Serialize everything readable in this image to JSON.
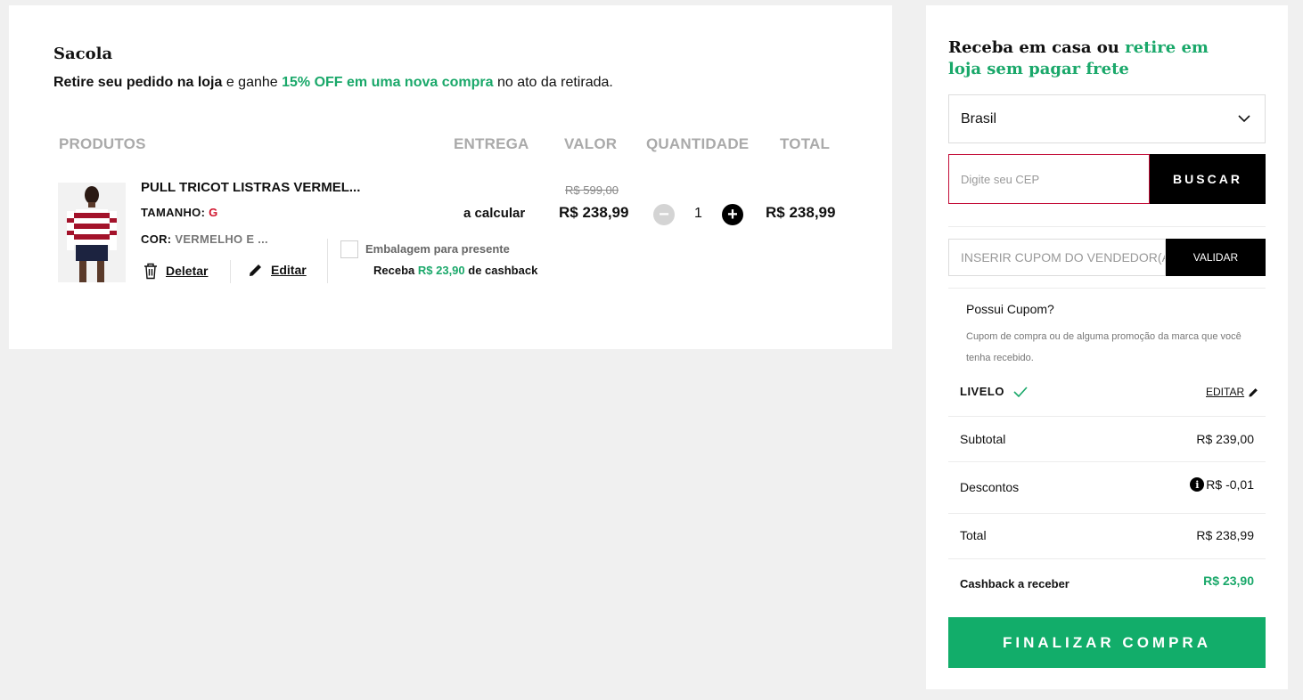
{
  "bag": {
    "title": "Sacola",
    "promo_bold": "Retire seu pedido na loja",
    "promo_mid": " e ganhe ",
    "promo_green": "15% OFF em uma nova compra",
    "promo_end": " no ato da retirada."
  },
  "columns": {
    "products": "PRODUTOS",
    "delivery": "ENTREGA",
    "value": "VALOR",
    "quantity": "QUANTIDADE",
    "total": "TOTAL"
  },
  "item": {
    "name": "PULL TRICOT LISTRAS VERMEL...",
    "size_label": "TAMANHO: ",
    "size_value": "G",
    "color_label": "COR: ",
    "color_value": "VERMELHO E ...",
    "delete_label": "Deletar",
    "edit_label": "Editar",
    "gift_label": "Embalagem para presente",
    "cashback_prefix": "Receba ",
    "cashback_value": "R$ 23,90",
    "cashback_suffix": " de cashback",
    "delivery": "a calcular",
    "old_price": "R$ 599,00",
    "price": "R$ 238,99",
    "quantity": "1",
    "total": "R$ 238,99",
    "minus": "−",
    "plus": "+"
  },
  "shipping": {
    "title_black": "Receba em casa ou ",
    "title_green": "retire em loja sem pagar frete",
    "country": "Brasil",
    "cep_placeholder": "Digite seu CEP",
    "search_button": "BUSCAR"
  },
  "coupon": {
    "placeholder": "INSERIR CUPOM DO VENDEDOR(A)",
    "validate_button": "VALIDAR",
    "question": "Possui Cupom?",
    "help": "Cupom de compra ou de alguma promoção da marca que você tenha recebido.",
    "livelo": "LIVELO",
    "edit": "EDITAR"
  },
  "summary": {
    "subtotal_label": "Subtotal",
    "subtotal_value": "R$ 239,00",
    "discount_label": "Descontos",
    "discount_value": "R$ -0,01",
    "total_label": "Total",
    "total_value": "R$ 238,99",
    "cashback_label": "Cashback a receber",
    "cashback_value": "R$ 23,90",
    "info_symbol": "i"
  },
  "finalize_button": "FINALIZAR COMPRA",
  "colors": {
    "accent_green": "#12ad6a",
    "size_red": "#d0142c",
    "cep_border": "#c4103a"
  },
  "icons": {
    "trash": "trash-icon",
    "pencil": "pencil-icon",
    "chevron": "chevron-down-icon",
    "check": "check-icon",
    "info": "info-icon"
  }
}
